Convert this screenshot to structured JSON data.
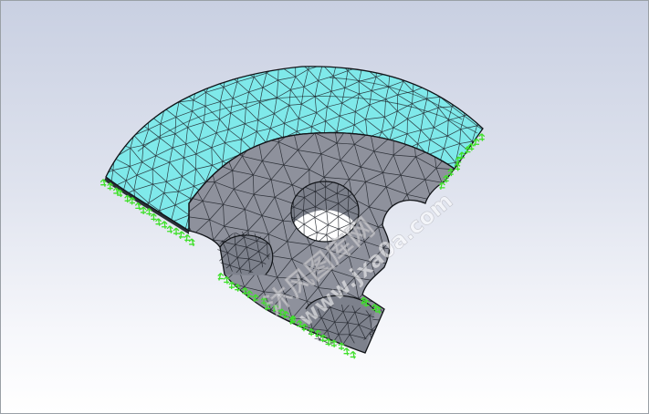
{
  "app": {
    "viewport_name": "graphics-area"
  },
  "model": {
    "top_surface_color": "#7fe9ea",
    "section_color": "#8e919c",
    "section_light": "#9a9ea8",
    "bore_color": "#7d818c",
    "mesh_line_color": "#1d2128",
    "fixture_color": "#3fe02a"
  },
  "watermark": {
    "line1": "沐风图库网",
    "line2": "www.jxa0a.com"
  }
}
